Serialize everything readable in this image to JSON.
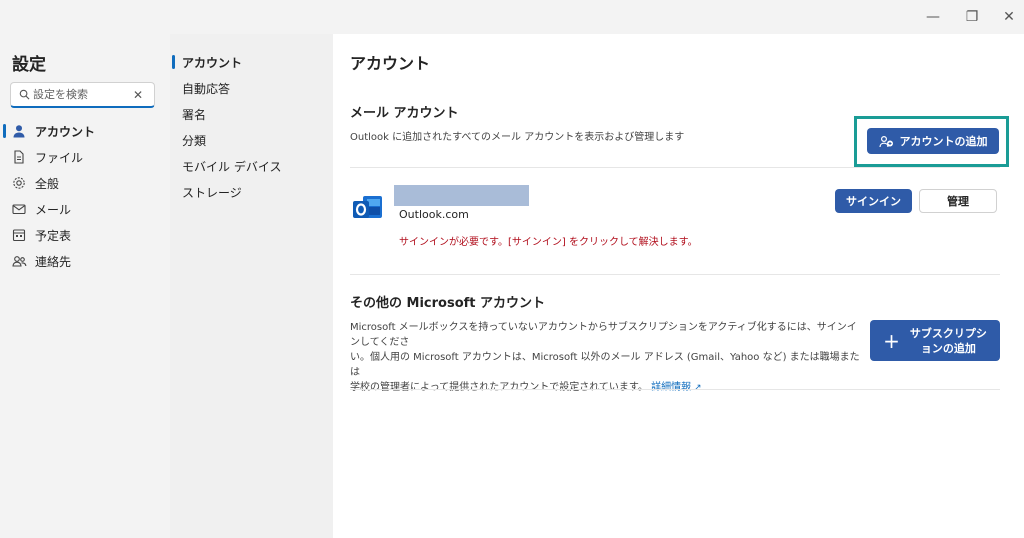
{
  "window": {
    "minimize_glyph": "—",
    "restore_glyph": "❐",
    "close_glyph": "✕"
  },
  "nav": {
    "title": "設定",
    "search": {
      "placeholder": "設定を検索",
      "value": ""
    },
    "items": [
      {
        "label": "アカウント",
        "icon": "person-icon",
        "active": true
      },
      {
        "label": "ファイル",
        "icon": "document-icon",
        "active": false
      },
      {
        "label": "全般",
        "icon": "gear-icon",
        "active": false
      },
      {
        "label": "メール",
        "icon": "mail-icon",
        "active": false
      },
      {
        "label": "予定表",
        "icon": "calendar-icon",
        "active": false
      },
      {
        "label": "連絡先",
        "icon": "people-icon",
        "active": false
      }
    ]
  },
  "subnav": {
    "items": [
      {
        "label": "アカウント",
        "active": true
      },
      {
        "label": "自動応答",
        "active": false
      },
      {
        "label": "署名",
        "active": false
      },
      {
        "label": "分類",
        "active": false
      },
      {
        "label": "モバイル デバイス",
        "active": false
      },
      {
        "label": "ストレージ",
        "active": false
      }
    ]
  },
  "main": {
    "title": "アカウント",
    "mail_accounts": {
      "title": "メール アカウント",
      "description": "Outlook に追加されたすべてのメール アカウントを表示および管理します",
      "add_button": "アカウントの追加",
      "account": {
        "type": "Outlook.com",
        "error": "サインインが必要です。[サインイン] をクリックして解決します。",
        "signin_button": "サインイン",
        "manage_button": "管理"
      }
    },
    "other_accounts": {
      "title": "その他の Microsoft アカウント",
      "description_1": "Microsoft メールボックスを持っていないアカウントからサブスクリプションをアクティブ化するには、サインインしてくださ",
      "description_2": "い。個人用の Microsoft アカウントは、Microsoft 以外のメール アドレス (Gmail、Yahoo など) または職場または",
      "description_3": "学校の管理者によって提供されたアカウントで設定されています。",
      "link": "詳細情報",
      "add_button_line1": "サブスクリプシ",
      "add_button_line2": "ョンの追加"
    }
  },
  "colors": {
    "accent": "#2f5ba8",
    "highlight": "#1a9c96",
    "error": "#b10e1c",
    "link": "#0f6cbd"
  }
}
